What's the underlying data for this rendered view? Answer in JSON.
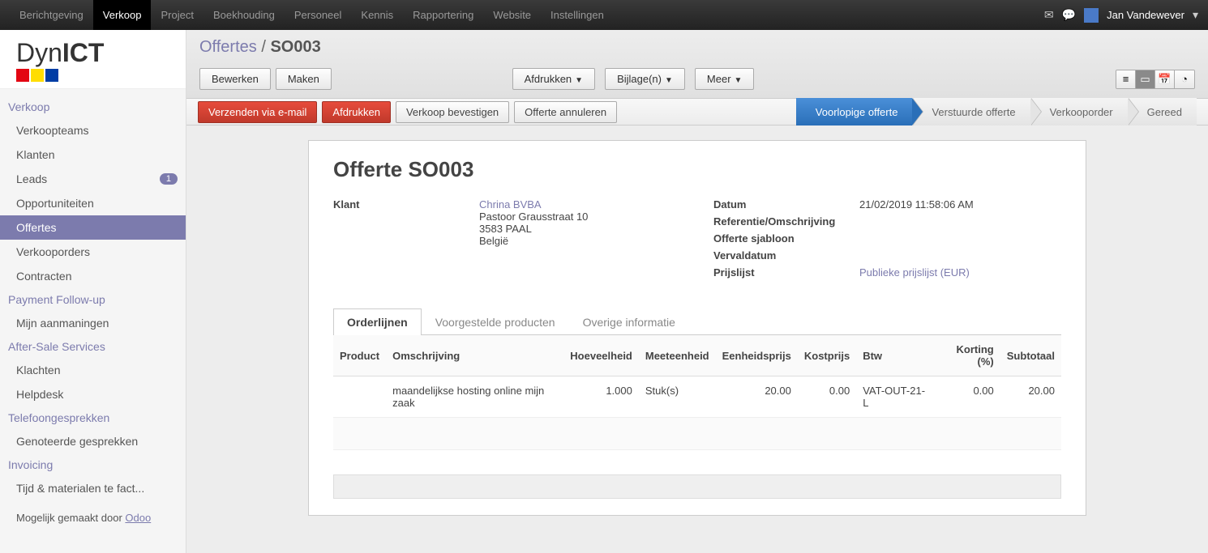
{
  "topnav": {
    "items": [
      "Berichtgeving",
      "Verkoop",
      "Project",
      "Boekhouding",
      "Personeel",
      "Kennis",
      "Rapportering",
      "Website",
      "Instellingen"
    ],
    "active_index": 1,
    "user": "Jan Vandewever"
  },
  "logo": {
    "part1": "Dyn",
    "part2": "ICT"
  },
  "sidebar": {
    "sections": [
      {
        "title": "Verkoop",
        "items": [
          {
            "label": "Verkoopteams"
          },
          {
            "label": "Klanten"
          },
          {
            "label": "Leads",
            "badge": "1"
          },
          {
            "label": "Opportuniteiten"
          },
          {
            "label": "Offertes",
            "active": true
          },
          {
            "label": "Verkooporders"
          },
          {
            "label": "Contracten"
          }
        ]
      },
      {
        "title": "Payment Follow-up",
        "items": [
          {
            "label": "Mijn aanmaningen"
          }
        ]
      },
      {
        "title": "After-Sale Services",
        "items": [
          {
            "label": "Klachten"
          },
          {
            "label": "Helpdesk"
          }
        ]
      },
      {
        "title": "Telefoongesprekken",
        "items": [
          {
            "label": "Genoteerde gesprekken"
          }
        ]
      },
      {
        "title": "Invoicing",
        "items": [
          {
            "label": "Tijd & materialen te fact..."
          }
        ]
      }
    ],
    "footer_prefix": "Mogelijk gemaakt door ",
    "footer_link": "Odoo"
  },
  "breadcrumb": {
    "root": "Offertes",
    "sep": "/",
    "current": "SO003"
  },
  "toolbar": {
    "edit": "Bewerken",
    "create": "Maken",
    "print": "Afdrukken",
    "attach": "Bijlage(n)",
    "more": "Meer"
  },
  "status_buttons": {
    "send_email": "Verzenden via e-mail",
    "print": "Afdrukken",
    "confirm": "Verkoop bevestigen",
    "cancel": "Offerte annuleren"
  },
  "stages": [
    "Voorlopige offerte",
    "Verstuurde offerte",
    "Verkooporder",
    "Gereed"
  ],
  "active_stage_index": 0,
  "record": {
    "title": "Offerte SO003",
    "klant_label": "Klant",
    "klant_name": "Chrina BVBA",
    "klant_addr1": "Pastoor Grausstraat 10",
    "klant_addr2": "3583 PAAL",
    "klant_country": "België",
    "datum_label": "Datum",
    "datum_value": "21/02/2019 11:58:06 AM",
    "ref_label": "Referentie/Omschrijving",
    "template_label": "Offerte sjabloon",
    "vervaldatum_label": "Vervaldatum",
    "prijslijst_label": "Prijslijst",
    "prijslijst_value": "Publieke prijslijst (EUR)"
  },
  "tabs": [
    "Orderlijnen",
    "Voorgestelde producten",
    "Overige informatie"
  ],
  "active_tab_index": 0,
  "table": {
    "headers": [
      "Product",
      "Omschrijving",
      "Hoeveelheid",
      "Meeteenheid",
      "Eenheidsprijs",
      "Kostprijs",
      "Btw",
      "Korting (%)",
      "Subtotaal"
    ],
    "rows": [
      {
        "product": "",
        "omschrijving": "maandelijkse hosting online mijn zaak",
        "hoeveelheid": "1.000",
        "meeteenheid": "Stuk(s)",
        "eenheidsprijs": "20.00",
        "kostprijs": "0.00",
        "btw": "VAT-OUT-21-L",
        "korting": "0.00",
        "subtotaal": "20.00"
      }
    ]
  }
}
